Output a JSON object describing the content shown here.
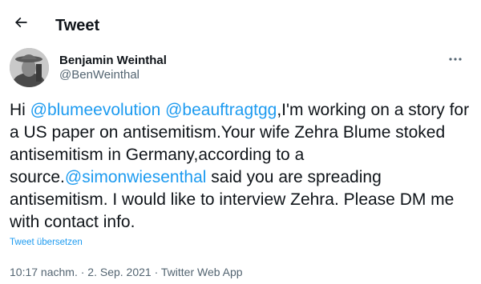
{
  "header": {
    "back_icon": "arrow-left-icon",
    "title": "Tweet"
  },
  "author": {
    "avatar_icon": "profile-photo",
    "name": "Benjamin Weinthal",
    "handle": "@BenWeinthal",
    "more_icon": "more-horizontal-icon"
  },
  "tweet": {
    "segments": [
      {
        "text": "Hi ",
        "type": "text"
      },
      {
        "text": "@blumeevolution",
        "type": "mention"
      },
      {
        "text": " ",
        "type": "text"
      },
      {
        "text": "@beauftragtgg",
        "type": "mention"
      },
      {
        "text": ",I'm working on a story for a US paper on antisemitism.Your wife Zehra Blume stoked antisemitism in Germany,according to a source.",
        "type": "text"
      },
      {
        "text": "@simonwiesenthal",
        "type": "mention"
      },
      {
        "text": " said you are spreading antisemitism. I would like to interview Zehra. Please DM me with contact info.",
        "type": "text"
      }
    ],
    "translate_label": "Tweet übersetzen"
  },
  "meta": {
    "time": "10:17 nachm.",
    "separator": " · ",
    "date": "2. Sep. 2021",
    "source": "Twitter Web App"
  },
  "colors": {
    "accent": "#1d9bf0",
    "text": "#0f1419",
    "secondary": "#536471"
  }
}
